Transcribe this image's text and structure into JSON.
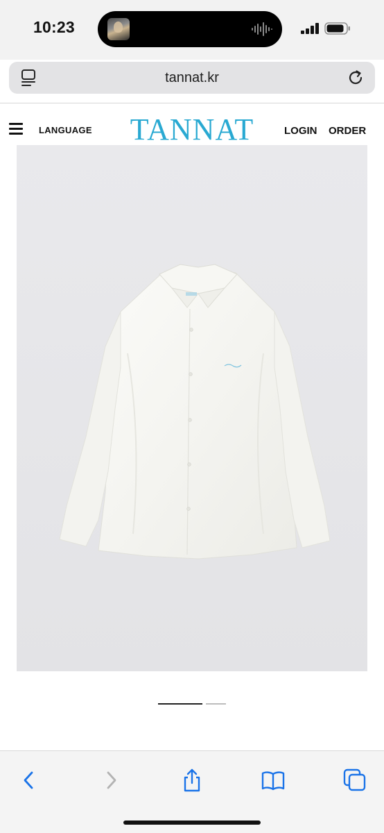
{
  "status_bar": {
    "time": "10:23"
  },
  "browser": {
    "url": "tannat.kr"
  },
  "header": {
    "language_label": "LANGUAGE",
    "logo_text": "TANNAT",
    "login_label": "LOGIN",
    "order_label": "ORDER"
  },
  "product": {
    "image_alt": "white shirt"
  },
  "carousel": {
    "current": 1,
    "total": 2
  },
  "toolbar": {
    "icons": [
      "back-icon",
      "forward-icon",
      "share-icon",
      "bookmarks-icon",
      "tabs-icon"
    ]
  },
  "colors": {
    "accent": "#2aa8d2",
    "ios_blue": "#1a73e8"
  }
}
